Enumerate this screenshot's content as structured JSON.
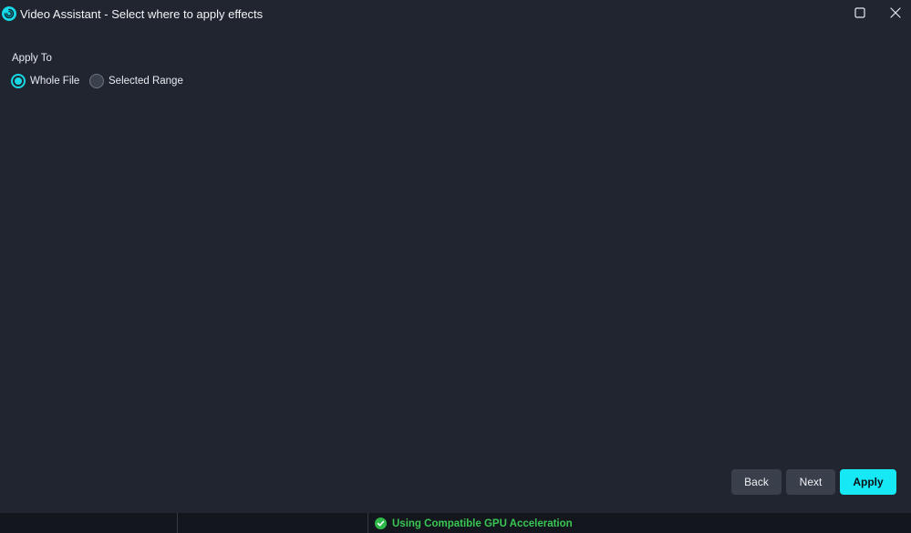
{
  "window": {
    "title": "Video Assistant - Select where to apply effects",
    "icons": {
      "app": "app-logo-icon",
      "maximize": "maximize-icon",
      "close": "close-icon"
    }
  },
  "apply_to": {
    "label": "Apply To",
    "options": [
      {
        "label": "Whole File",
        "selected": true
      },
      {
        "label": "Selected Range",
        "selected": false
      }
    ]
  },
  "buttons": {
    "back": "Back",
    "next": "Next",
    "apply": "Apply"
  },
  "status": {
    "message": "Using Compatible GPU Acceleration",
    "icon": "check-circle-icon",
    "color": "#39c653"
  },
  "colors": {
    "accent": "#16d8e6",
    "background": "#20252f",
    "button": "#393f4b",
    "statusbar": "#13161c"
  }
}
